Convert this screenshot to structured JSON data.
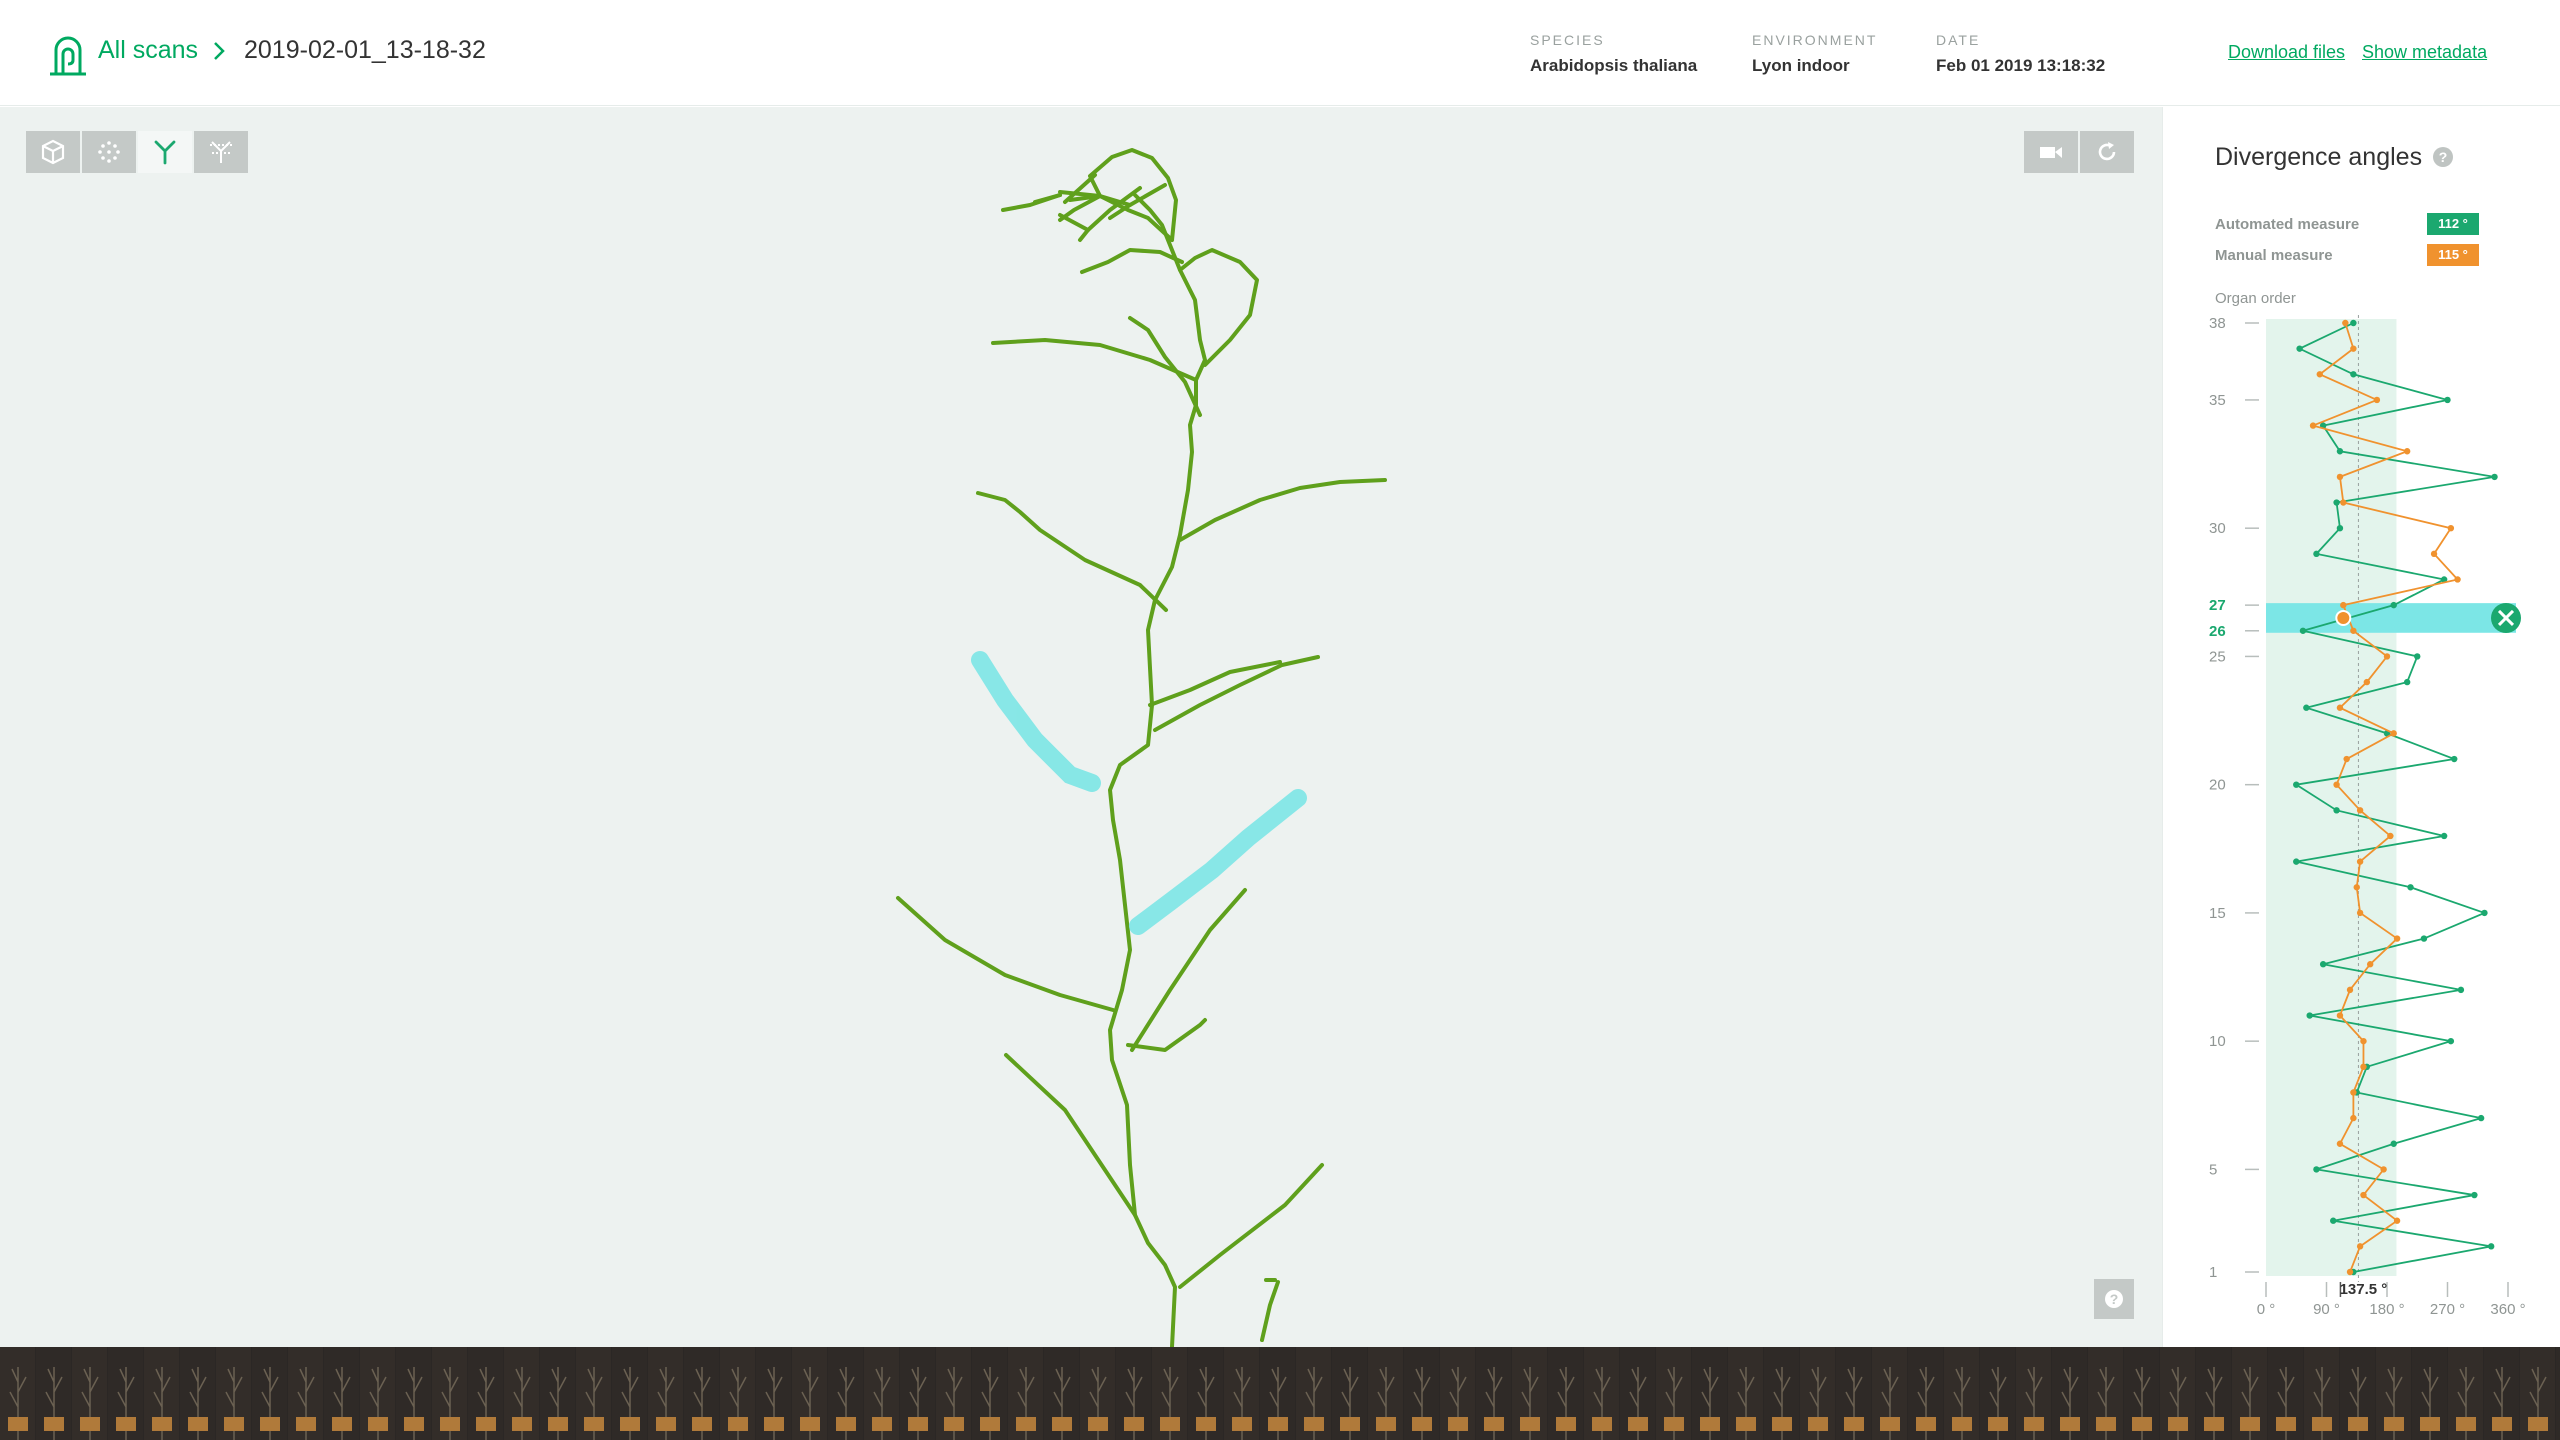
{
  "header": {
    "breadcrumb_all": "All scans",
    "scan_name": "2019-02-01_13-18-32",
    "species_label": "SPECIES",
    "species_value": "Arabidopsis thaliana",
    "environment_label": "ENVIRONMENT",
    "environment_value": "Lyon indoor",
    "date_label": "DATE",
    "date_value": "Feb 01 2019 13:18:32",
    "download_link": "Download files",
    "metadata_link": "Show metadata"
  },
  "toolbar": {
    "left_tools": [
      "mesh-icon",
      "point-cloud-icon",
      "skeleton-icon",
      "segmentation-icon"
    ],
    "active_tool": "skeleton-icon",
    "right_tools": [
      "camera-icon",
      "reset-view-icon"
    ]
  },
  "panel": {
    "title": "Divergence angles",
    "automated_label": "Automated measure",
    "automated_value": "112 °",
    "manual_label": "Manual measure",
    "manual_value": "115 °",
    "organ_order_label": "Organ order"
  },
  "colors": {
    "accent": "#00a960",
    "automated": "#1ba86f",
    "manual": "#f0922e",
    "highlight": "#7ce6e6",
    "plant": "#5fa01c"
  },
  "chart_data": {
    "type": "line",
    "title": "Divergence angles",
    "ylabel": "Organ order",
    "ylim": [
      1,
      38
    ],
    "xlim": [
      0,
      360
    ],
    "y_ticks": [
      1,
      5,
      10,
      15,
      20,
      25,
      26,
      27,
      30,
      35,
      38
    ],
    "x_tick_labels": [
      "0 °",
      "90 °",
      "180 °",
      "270 °",
      "360 °"
    ],
    "x_ticks": [
      0,
      90,
      180,
      270,
      360
    ],
    "reference_value": 137.5,
    "reference_label": "137.5 °",
    "selected_range": [
      26,
      27
    ],
    "series": [
      {
        "name": "Automated measure",
        "x": [
          130,
          335,
          100,
          310,
          75,
          190,
          320,
          135,
          150,
          275,
          65,
          290,
          85,
          235,
          325,
          215,
          45,
          265,
          105,
          45,
          280,
          180,
          60,
          210,
          225,
          55,
          190,
          265,
          75,
          110,
          105,
          340,
          110,
          85,
          270,
          130,
          50,
          130
        ],
        "y": [
          1,
          2,
          3,
          4,
          5,
          6,
          7,
          8,
          9,
          10,
          11,
          12,
          13,
          14,
          15,
          16,
          17,
          18,
          19,
          20,
          21,
          22,
          23,
          24,
          25,
          26,
          27,
          28,
          29,
          30,
          31,
          32,
          33,
          34,
          35,
          36,
          37,
          38
        ]
      },
      {
        "name": "Manual measure",
        "x": [
          125,
          140,
          195,
          145,
          175,
          110,
          130,
          130,
          145,
          145,
          110,
          125,
          155,
          195,
          140,
          135,
          140,
          185,
          140,
          105,
          120,
          190,
          110,
          150,
          180,
          130,
          115,
          285,
          250,
          275,
          115,
          110,
          210,
          70,
          165,
          80,
          130,
          118
        ],
        "y": [
          1,
          2,
          3,
          4,
          5,
          6,
          7,
          8,
          9,
          10,
          11,
          12,
          13,
          14,
          15,
          16,
          17,
          18,
          19,
          20,
          21,
          22,
          23,
          24,
          25,
          26,
          27,
          28,
          29,
          30,
          31,
          32,
          33,
          34,
          35,
          36,
          37,
          38
        ]
      }
    ]
  }
}
